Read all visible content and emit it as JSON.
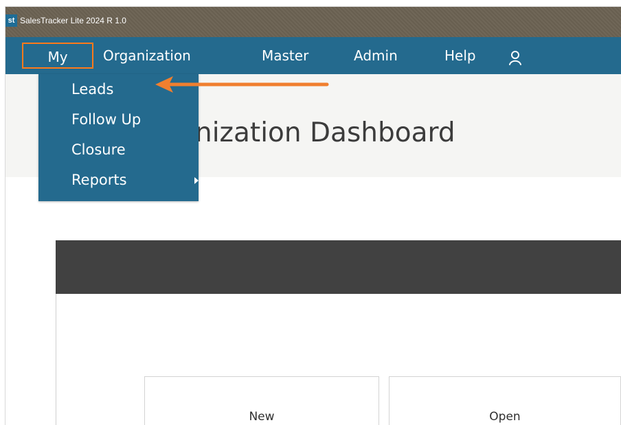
{
  "app": {
    "icon": "st",
    "title": "SalesTracker Lite 2024 R 1.0"
  },
  "menubar": {
    "items": [
      {
        "label": "My"
      },
      {
        "label": "Organization"
      },
      {
        "label": "Master"
      },
      {
        "label": "Admin"
      },
      {
        "label": "Help"
      }
    ],
    "user_icon": "user-icon"
  },
  "dropdown": {
    "items": [
      {
        "label": "Leads"
      },
      {
        "label": "Follow Up"
      },
      {
        "label": "Closure"
      },
      {
        "label": "Reports"
      }
    ],
    "submenu_icon": "chevron-right-icon"
  },
  "main": {
    "visible_title": "nization Dashboard",
    "stats": [
      {
        "label": "New"
      },
      {
        "label": "Open"
      }
    ]
  },
  "annotation": {
    "color": "#f07f2f"
  },
  "colors": {
    "menu_bg": "#246a8e",
    "titlebar_bg": "#6b6253",
    "highlight_border": "#ff7a1a",
    "card_header": "#414141"
  }
}
